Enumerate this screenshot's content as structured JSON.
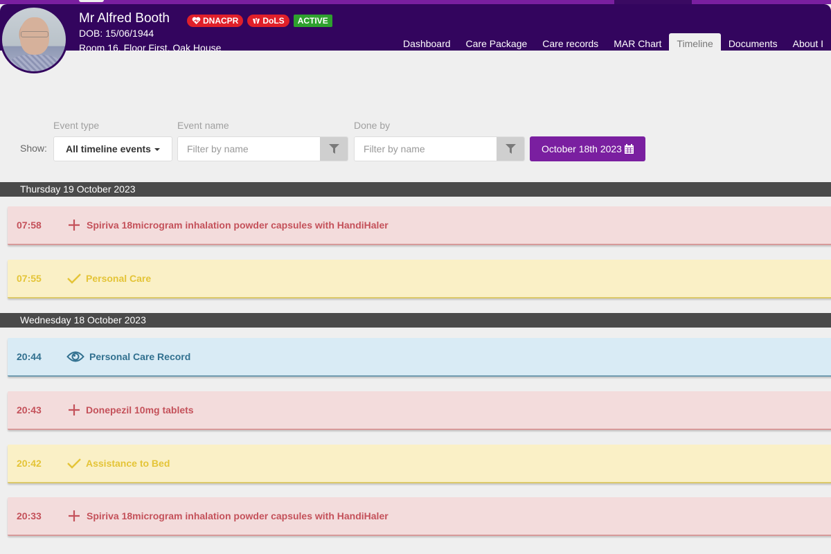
{
  "patient": {
    "name": "Mr Alfred Booth",
    "dob": "DOB: 15/06/1944",
    "room": "Room 16, Floor First, Oak House",
    "badges": [
      {
        "label": "DNACPR",
        "icon": "heart-icon",
        "color": "#e0202a"
      },
      {
        "label": "DoLS",
        "icon": "hands-icon",
        "color": "#e0202a"
      },
      {
        "label": "ACTIVE",
        "icon": "",
        "color": "#2ea02e"
      }
    ]
  },
  "nav": {
    "items": [
      {
        "label": "Dashboard",
        "active": false
      },
      {
        "label": "Care Package",
        "active": false
      },
      {
        "label": "Care records",
        "active": false
      },
      {
        "label": "MAR Chart",
        "active": false
      },
      {
        "label": "Timeline",
        "active": true
      },
      {
        "label": "Documents",
        "active": false
      },
      {
        "label": "About I",
        "active": false
      }
    ]
  },
  "filters": {
    "show_label": "Show:",
    "event_type_label": "Event type",
    "event_type_value": "All timeline events",
    "event_name_label": "Event name",
    "event_name_placeholder": "Filter by name",
    "done_by_label": "Done by",
    "done_by_placeholder": "Filter by name",
    "date_value": "October 18th 2023"
  },
  "colors": {
    "brand_dark": "#33055e",
    "brand_accent": "#7a1fa0",
    "medication": "#c4515a",
    "care_done": "#e4c437",
    "record_view": "#31708f"
  },
  "timeline": [
    {
      "day": "Thursday 19 October 2023",
      "events": [
        {
          "time": "07:58",
          "type": "medication",
          "icon": "plus-icon",
          "title": "Spiriva 18microgram inhalation powder capsules with HandiHaler"
        },
        {
          "time": "07:55",
          "type": "care",
          "icon": "check-icon",
          "title": "Personal Care"
        }
      ]
    },
    {
      "day": "Wednesday 18 October 2023",
      "events": [
        {
          "time": "20:44",
          "type": "record",
          "icon": "eye-icon",
          "title": "Personal Care Record"
        },
        {
          "time": "20:43",
          "type": "medication",
          "icon": "plus-icon",
          "title": "Donepezil 10mg tablets"
        },
        {
          "time": "20:42",
          "type": "care",
          "icon": "check-icon",
          "title": "Assistance to Bed"
        },
        {
          "time": "20:33",
          "type": "medication",
          "icon": "plus-icon",
          "title": "Spiriva 18microgram inhalation powder capsules with HandiHaler"
        }
      ]
    }
  ]
}
